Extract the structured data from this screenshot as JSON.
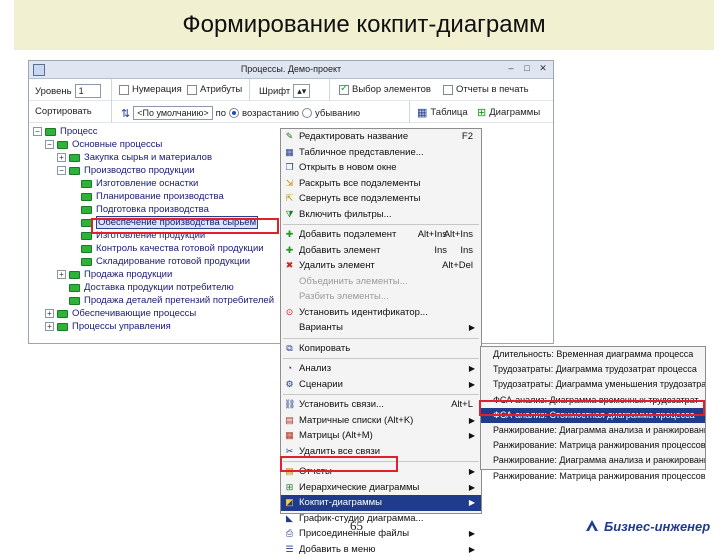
{
  "slide": {
    "title": "Формирование кокпит-диаграмм",
    "page_number": "65",
    "brand": "Бизнес-инженер"
  },
  "window": {
    "title": "Процессы. Демо-проект",
    "buttons": [
      "–",
      "□",
      "✕"
    ]
  },
  "toolbar1": {
    "level_label": "Уровень",
    "level_value": "1",
    "decomposition": "Нумерация",
    "attributes": "Атрибуты",
    "font": "Шрифт",
    "selected_elements": "Выбор элементов",
    "reports": "Отчеты в печать"
  },
  "toolbar2": {
    "sorting_label": "Сортировать",
    "sort_value": "<По умолчанию>",
    "sort_suffix": "по",
    "ascending": "возрастанию",
    "descending": "убыванию",
    "table": "Таблица",
    "diagrams": "Диаграммы"
  },
  "tree": [
    {
      "label": "Процесс",
      "level": 0,
      "expander": "−"
    },
    {
      "label": "Основные процессы",
      "level": 1,
      "expander": "−"
    },
    {
      "label": "Закупка сырья и материалов",
      "level": 2,
      "expander": "+"
    },
    {
      "label": "Производство продукции",
      "level": 2,
      "expander": "−"
    },
    {
      "label": "Изготовление оснастки",
      "level": 3,
      "expander": ""
    },
    {
      "label": "Планирование производства",
      "level": 3,
      "expander": ""
    },
    {
      "label": "Подготовка производства",
      "level": 3,
      "expander": ""
    },
    {
      "label": "Обеспечение производства сырьем",
      "level": 3,
      "expander": ""
    },
    {
      "label": "Изготовление продукции",
      "level": 3,
      "expander": ""
    },
    {
      "label": "Контроль качества готовой продукции",
      "level": 3,
      "expander": ""
    },
    {
      "label": "Складирование готовой продукции",
      "level": 3,
      "expander": ""
    },
    {
      "label": "Продажа продукции",
      "level": 2,
      "expander": "+"
    },
    {
      "label": "Доставка продукции потребителю",
      "level": 2,
      "expander": ""
    },
    {
      "label": "Продажа деталей претензий потребителей",
      "level": 2,
      "expander": ""
    },
    {
      "label": "Обеспечивающие процессы",
      "level": 1,
      "expander": "+"
    },
    {
      "label": "Процессы управления",
      "level": 1,
      "expander": "+"
    }
  ],
  "context_menu": [
    {
      "label": "Редактировать название",
      "shortcut": "F2",
      "icon": "edit-icon",
      "glyph": "✎",
      "color": "#1a7a23"
    },
    {
      "label": "Табличное представление...",
      "icon": "table-icon",
      "glyph": "▦",
      "color": "#1f3c8c"
    },
    {
      "label": "Открыть в новом окне",
      "icon": "window-icon",
      "glyph": "❐",
      "color": "#1f3c8c"
    },
    {
      "label": "Раскрыть все подэлементы",
      "icon": "expand-icon",
      "glyph": "⇲",
      "color": "#c08a00"
    },
    {
      "label": "Свернуть все подэлементы",
      "icon": "collapse-icon",
      "glyph": "⇱",
      "color": "#c08a00"
    },
    {
      "label": "Включить фильтры...",
      "icon": "filter-icon",
      "glyph": "⧩",
      "color": "#1a7a23"
    },
    {
      "sep": true
    },
    {
      "label": "Добавить подэлемент",
      "shortcut": "Alt+Ins",
      "shortcut2": "Alt+Ins",
      "icon": "add-child-icon",
      "glyph": "✚",
      "color": "#1a9a23"
    },
    {
      "label": "Добавить элемент",
      "shortcut": "Ins",
      "shortcut2": "Ins",
      "icon": "add-icon",
      "glyph": "✚",
      "color": "#1a9a23"
    },
    {
      "label": "Удалить элемент",
      "shortcut": "Alt+Del",
      "icon": "delete-icon",
      "glyph": "✖",
      "color": "#d02020"
    },
    {
      "label": "Объединить элементы...",
      "disabled": true,
      "icon": "merge-icon",
      "glyph": "",
      "color": "#999"
    },
    {
      "label": "Разбить элементы...",
      "disabled": true,
      "icon": "split-icon",
      "glyph": "",
      "color": "#999"
    },
    {
      "label": "Установить идентификатор...",
      "icon": "id-icon",
      "glyph": "⊙",
      "color": "#c02020"
    },
    {
      "label": "Варианты",
      "arrow": true,
      "icon": "variants-icon",
      "glyph": "",
      "color": "#999"
    },
    {
      "sep": true
    },
    {
      "label": "Копировать",
      "icon": "copy-icon",
      "glyph": "⧉",
      "color": "#1f3c8c"
    },
    {
      "sep": true
    },
    {
      "label": "Анализ",
      "arrow": true,
      "icon": "analysis-icon",
      "glyph": "◔",
      "color": "#1f3c8c"
    },
    {
      "label": "Сценарии",
      "arrow": true,
      "icon": "scenario-icon",
      "glyph": "⚙",
      "color": "#1f3c8c"
    },
    {
      "sep": true
    },
    {
      "label": "Установить связи...",
      "shortcut": "Alt+L",
      "icon": "link-icon",
      "glyph": "⛓",
      "color": "#1f3c8c"
    },
    {
      "label": "Матричные списки (Alt+K)",
      "arrow": true,
      "icon": "matrix-list-icon",
      "glyph": "▤",
      "color": "#b03020"
    },
    {
      "label": "Матрицы (Alt+M)",
      "arrow": true,
      "icon": "matrix-icon",
      "glyph": "▦",
      "color": "#b03020"
    },
    {
      "label": "Удалить все связи",
      "icon": "unlink-icon",
      "glyph": "✂",
      "color": "#1f3c8c"
    },
    {
      "sep": true
    },
    {
      "label": "Отчеты",
      "arrow": true,
      "icon": "reports-icon",
      "glyph": "▤",
      "color": "#c08a00"
    },
    {
      "label": "Иерархические диаграммы",
      "arrow": true,
      "icon": "hierarchy-icon",
      "glyph": "⊞",
      "color": "#1a7a23"
    },
    {
      "label": "Кокпит-диаграммы",
      "arrow": true,
      "highlighted": true,
      "icon": "cockpit-icon",
      "glyph": "◩",
      "color": "#ffcc33"
    },
    {
      "label": "График-студио диаграмма...",
      "icon": "graph-icon",
      "glyph": "◣",
      "color": "#1f3c8c"
    },
    {
      "label": "Присоединенные файлы",
      "arrow": true,
      "icon": "attach-icon",
      "glyph": "⎙",
      "color": "#1f3c8c"
    },
    {
      "label": "Добавить в меню",
      "arrow": true,
      "icon": "menu-add-icon",
      "glyph": "☰",
      "color": "#1f3c8c"
    }
  ],
  "submenu": [
    {
      "label": "Длительность: Временная диаграмма процесса"
    },
    {
      "label": "Трудозатраты: Диаграмма трудозатрат процесса"
    },
    {
      "label": "Трудозатраты: Диаграмма уменьшения трудозатрат"
    },
    {
      "label": "ФСА-анализ: Диаграмма временных трудозатрат"
    },
    {
      "label": "ФСА-анализ: Стоимостная диаграмма процесса",
      "highlighted": true
    },
    {
      "label": "Ранжирование: Диаграмма анализа и ранжирования"
    },
    {
      "label": "Ранжирование: Матрица ранжирования процессов"
    },
    {
      "label": "Ранжирование: Диаграмма анализа и ранжирования"
    },
    {
      "label": "Ранжирование: Матрица ранжирования процессов"
    }
  ],
  "colors": {
    "highlight": "#1f3c8c",
    "callout": "#e0202a",
    "title_bg": "#f1f1d2"
  }
}
